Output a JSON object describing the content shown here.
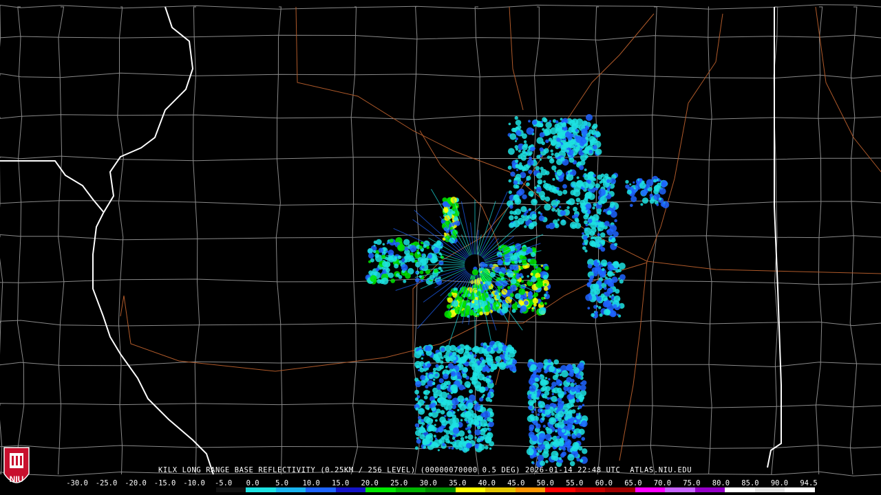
{
  "caption": "KILX LONG RANGE BASE REFLECTIVITY (0.25KM / 256 LEVEL) (00000070000 0.5 DEG) 2026-01-14 22:48 UTC  ATLAS.NIU.EDU",
  "logo_text": "NIU",
  "scale": {
    "labels": [
      "-30.0",
      "-25.0",
      "-20.0",
      "-15.0",
      "-10.0",
      "-5.0",
      "0.0",
      "5.0",
      "10.0",
      "15.0",
      "20.0",
      "25.0",
      "30.0",
      "35.0",
      "40.0",
      "45.0",
      "50.0",
      "55.0",
      "60.0",
      "65.0",
      "70.0",
      "75.0",
      "80.0",
      "85.0",
      "90.0",
      "94.5"
    ],
    "colors": [
      "#000000",
      "#000000",
      "#000000",
      "#000000",
      "#000000",
      "#111111",
      "#1de2e2",
      "#19b4f0",
      "#1e64ff",
      "#1414c8",
      "#00e600",
      "#00b400",
      "#008c00",
      "#ffff00",
      "#e6c800",
      "#ff9600",
      "#ff0000",
      "#c80000",
      "#a00000",
      "#ff00ff",
      "#c864ff",
      "#9600c8",
      "#ffffff",
      "#e6e6e6",
      "#ffffff"
    ]
  },
  "colors": {
    "background": "#000000",
    "county_border": "#8a8a8a",
    "state_border": "#ffffff",
    "roads": "#b05a2a",
    "echo_light": "#1de2e2",
    "echo_medium": "#1e64ff",
    "echo_strong": "#00e600",
    "echo_heavy": "#ffff00"
  }
}
